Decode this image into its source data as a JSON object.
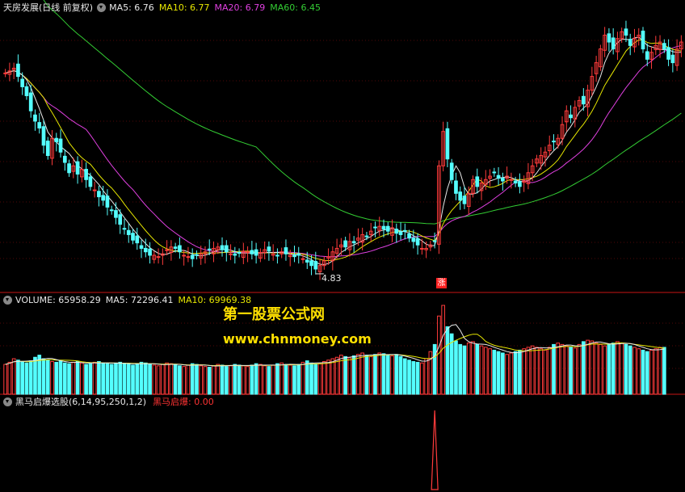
{
  "price_panel": {
    "title": "天房发展(日线 前复权)",
    "ma_labels": [
      {
        "text": "MA5: 6.76",
        "color": "#e8e8e8"
      },
      {
        "text": "MA10: 6.77",
        "color": "#e6e600"
      },
      {
        "text": "MA20: 6.79",
        "color": "#e040e0"
      },
      {
        "text": "MA60: 6.45",
        "color": "#33cc33"
      }
    ],
    "low_marker": "4.83",
    "signal_marker": "涨"
  },
  "volume_panel": {
    "labels": [
      {
        "text": "VOLUME: 65958.29",
        "color": "#e8e8e8"
      },
      {
        "text": "MA5: 72296.41",
        "color": "#e8e8e8"
      },
      {
        "text": "MA10: 69969.38",
        "color": "#e6e600"
      }
    ]
  },
  "indicator_panel": {
    "title": "黑马启爆选股(6,14,95,250,1,2)",
    "value_label": "黑马启爆: 0.00",
    "value_color": "#ff3333"
  },
  "watermark": {
    "line1": "第一股票公式网",
    "line2": "www.chnmoney.com",
    "color": "#ffe000"
  },
  "colors": {
    "up": "#ff3b3b",
    "down": "#54ffff",
    "grid": "#a01010",
    "ma5": "#e8e8e8",
    "ma10": "#e6e600",
    "ma20": "#e040e0",
    "ma60": "#33cc33"
  },
  "chart_data": {
    "type": "candlestick",
    "price_range": [
      4.7,
      8.6
    ],
    "volume_range": [
      0,
      125000
    ],
    "low_value": 4.83,
    "signal_index": 101,
    "closes": [
      7.75,
      7.78,
      7.82,
      7.7,
      7.55,
      7.42,
      7.2,
      7.05,
      6.95,
      6.7,
      6.55,
      6.8,
      6.75,
      6.6,
      6.45,
      6.3,
      6.4,
      6.28,
      6.35,
      6.2,
      6.1,
      6.05,
      5.95,
      5.9,
      5.8,
      5.75,
      5.65,
      5.55,
      5.48,
      5.4,
      5.32,
      5.28,
      5.2,
      5.15,
      5.1,
      5.1,
      5.08,
      5.12,
      5.18,
      5.22,
      5.2,
      5.15,
      5.1,
      5.08,
      5.05,
      5.1,
      5.12,
      5.15,
      5.18,
      5.2,
      5.22,
      5.18,
      5.15,
      5.12,
      5.1,
      5.13,
      5.16,
      5.15,
      5.12,
      5.1,
      5.14,
      5.18,
      5.16,
      5.12,
      5.1,
      5.15,
      5.12,
      5.1,
      5.08,
      5.1,
      5.05,
      5.0,
      4.95,
      4.9,
      4.95,
      5.02,
      5.08,
      5.15,
      5.2,
      5.25,
      5.22,
      5.3,
      5.28,
      5.35,
      5.4,
      5.38,
      5.45,
      5.5,
      5.52,
      5.48,
      5.45,
      5.5,
      5.42,
      5.4,
      5.45,
      5.35,
      5.3,
      5.25,
      5.2,
      5.2,
      5.25,
      5.3,
      6.4,
      6.9,
      6.5,
      6.2,
      6.0,
      5.9,
      5.85,
      6.0,
      6.2,
      6.1,
      6.15,
      6.2,
      6.25,
      6.3,
      6.22,
      6.18,
      6.25,
      6.2,
      6.15,
      6.1,
      6.18,
      6.3,
      6.4,
      6.5,
      6.55,
      6.6,
      6.7,
      6.75,
      6.8,
      7.0,
      7.2,
      7.1,
      7.25,
      7.35,
      7.3,
      7.5,
      7.7,
      7.9,
      8.1,
      8.3,
      8.2,
      8.1,
      8.25,
      8.35,
      8.3,
      8.15,
      8.25,
      8.3,
      8.1,
      7.95,
      8.05,
      8.15,
      8.2,
      8.1,
      7.95,
      7.9,
      8.1,
      8.2
    ],
    "volumes": [
      42000,
      45000,
      50000,
      48000,
      46000,
      44000,
      47000,
      52000,
      55000,
      50000,
      48000,
      46000,
      45000,
      47000,
      44000,
      43000,
      45000,
      46000,
      44000,
      42000,
      43000,
      45000,
      46000,
      44000,
      43000,
      42000,
      44000,
      45000,
      43000,
      42000,
      41000,
      43000,
      45000,
      44000,
      42000,
      41000,
      40000,
      42000,
      44000,
      43000,
      41000,
      40000,
      39000,
      41000,
      43000,
      42000,
      40000,
      39000,
      38000,
      40000,
      42000,
      41000,
      39000,
      40000,
      42000,
      41000,
      40000,
      39000,
      41000,
      43000,
      42000,
      40000,
      39000,
      41000,
      43000,
      44000,
      42000,
      41000,
      40000,
      42000,
      45000,
      47000,
      44000,
      42000,
      43000,
      46000,
      48000,
      50000,
      52000,
      55000,
      53000,
      51000,
      54000,
      56000,
      58000,
      55000,
      53000,
      56000,
      58000,
      57000,
      55000,
      54000,
      56000,
      53000,
      50000,
      48000,
      46000,
      45000,
      44000,
      50000,
      60000,
      70000,
      110000,
      125000,
      95000,
      85000,
      75000,
      70000,
      68000,
      72000,
      74000,
      70000,
      68000,
      66000,
      64000,
      62000,
      60000,
      58000,
      56000,
      58000,
      60000,
      62000,
      64000,
      66000,
      68000,
      66000,
      64000,
      62000,
      66000,
      70000,
      72000,
      70000,
      68000,
      66000,
      65000,
      70000,
      74000,
      76000,
      75000,
      72000,
      70000,
      68000,
      70000,
      72000,
      74000,
      72000,
      70000,
      68000,
      66000,
      64000,
      62000,
      60000,
      62000,
      64000,
      66000,
      65958
    ]
  }
}
